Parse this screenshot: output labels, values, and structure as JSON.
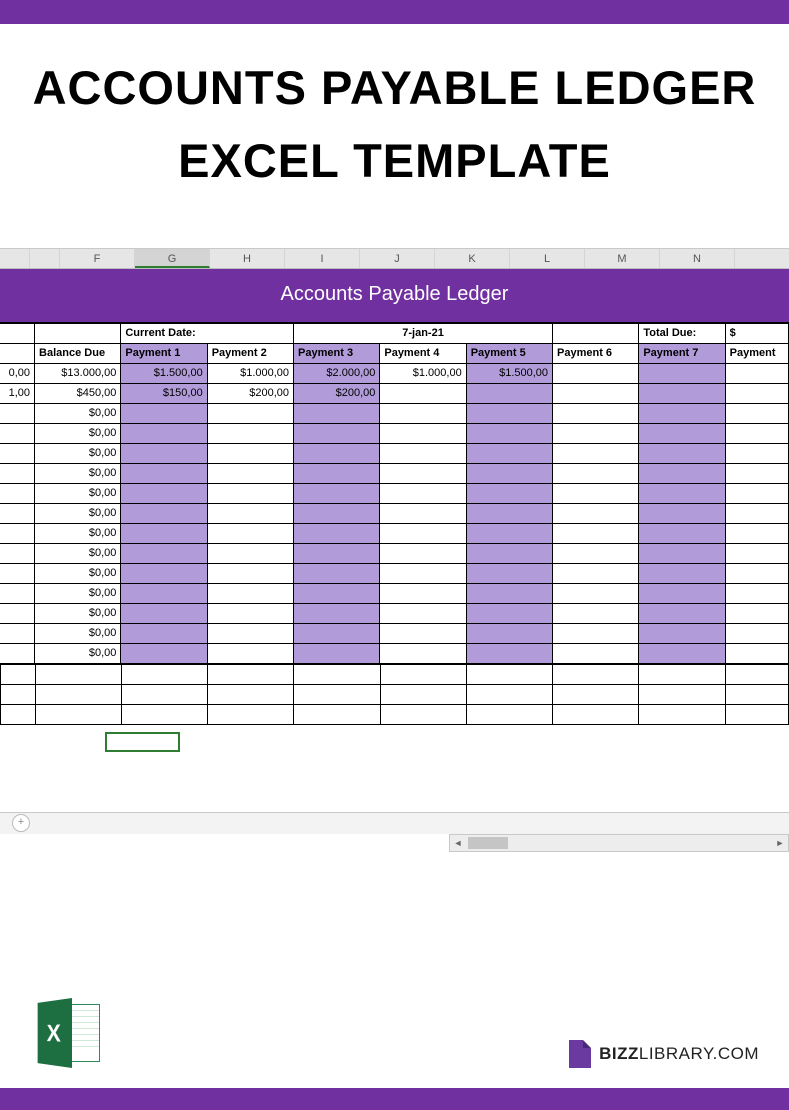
{
  "title_line1": "ACCOUNTS PAYABLE LEDGER",
  "title_line2": "EXCEL TEMPLATE",
  "columns": [
    "F",
    "G",
    "H",
    "I",
    "J",
    "K",
    "L",
    "M",
    "N"
  ],
  "selected_column_index": 1,
  "ledger_title": "Accounts Payable Ledger",
  "meta_row": {
    "current_date_label": "Current Date:",
    "current_date_value": "7-jan-21",
    "total_due_label": "Total Due:",
    "total_due_value": "$"
  },
  "headers": {
    "balance_due": "Balance Due",
    "p1": "Payment 1",
    "p2": "Payment 2",
    "p3": "Payment 3",
    "p4": "Payment 4",
    "p5": "Payment 5",
    "p6": "Payment 6",
    "p7": "Payment 7",
    "p8": "Payment"
  },
  "rows": [
    {
      "lead": "0,00",
      "balance": "$13.000,00",
      "p1": "$1.500,00",
      "p2": "$1.000,00",
      "p3": "$2.000,00",
      "p4": "$1.000,00",
      "p5": "$1.500,00",
      "p6": "",
      "p7": "",
      "p8": ""
    },
    {
      "lead": "1,00",
      "balance": "$450,00",
      "p1": "$150,00",
      "p2": "$200,00",
      "p3": "$200,00",
      "p4": "",
      "p5": "",
      "p6": "",
      "p7": "",
      "p8": ""
    },
    {
      "lead": "",
      "balance": "$0,00",
      "p1": "",
      "p2": "",
      "p3": "",
      "p4": "",
      "p5": "",
      "p6": "",
      "p7": "",
      "p8": ""
    },
    {
      "lead": "",
      "balance": "$0,00",
      "p1": "",
      "p2": "",
      "p3": "",
      "p4": "",
      "p5": "",
      "p6": "",
      "p7": "",
      "p8": ""
    },
    {
      "lead": "",
      "balance": "$0,00",
      "p1": "",
      "p2": "",
      "p3": "",
      "p4": "",
      "p5": "",
      "p6": "",
      "p7": "",
      "p8": ""
    },
    {
      "lead": "",
      "balance": "$0,00",
      "p1": "",
      "p2": "",
      "p3": "",
      "p4": "",
      "p5": "",
      "p6": "",
      "p7": "",
      "p8": ""
    },
    {
      "lead": "",
      "balance": "$0,00",
      "p1": "",
      "p2": "",
      "p3": "",
      "p4": "",
      "p5": "",
      "p6": "",
      "p7": "",
      "p8": ""
    },
    {
      "lead": "",
      "balance": "$0,00",
      "p1": "",
      "p2": "",
      "p3": "",
      "p4": "",
      "p5": "",
      "p6": "",
      "p7": "",
      "p8": ""
    },
    {
      "lead": "",
      "balance": "$0,00",
      "p1": "",
      "p2": "",
      "p3": "",
      "p4": "",
      "p5": "",
      "p6": "",
      "p7": "",
      "p8": ""
    },
    {
      "lead": "",
      "balance": "$0,00",
      "p1": "",
      "p2": "",
      "p3": "",
      "p4": "",
      "p5": "",
      "p6": "",
      "p7": "",
      "p8": ""
    },
    {
      "lead": "",
      "balance": "$0,00",
      "p1": "",
      "p2": "",
      "p3": "",
      "p4": "",
      "p5": "",
      "p6": "",
      "p7": "",
      "p8": ""
    },
    {
      "lead": "",
      "balance": "$0,00",
      "p1": "",
      "p2": "",
      "p3": "",
      "p4": "",
      "p5": "",
      "p6": "",
      "p7": "",
      "p8": ""
    },
    {
      "lead": "",
      "balance": "$0,00",
      "p1": "",
      "p2": "",
      "p3": "",
      "p4": "",
      "p5": "",
      "p6": "",
      "p7": "",
      "p8": ""
    },
    {
      "lead": "",
      "balance": "$0,00",
      "p1": "",
      "p2": "",
      "p3": "",
      "p4": "",
      "p5": "",
      "p6": "",
      "p7": "",
      "p8": ""
    },
    {
      "lead": "",
      "balance": "$0,00",
      "p1": "",
      "p2": "",
      "p3": "",
      "p4": "",
      "p5": "",
      "p6": "",
      "p7": "",
      "p8": ""
    }
  ],
  "tab_add": "+",
  "excel_letter": "X",
  "brand_bold": "BIZZ",
  "brand_rest": "LIBRARY.COM"
}
